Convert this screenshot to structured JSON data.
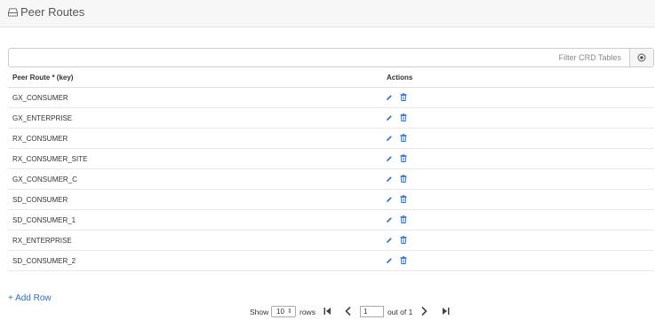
{
  "header": {
    "title": "Peer Routes",
    "icon": "hdd-icon"
  },
  "filter": {
    "placeholder": "Filter CRD Tables",
    "value": ""
  },
  "table": {
    "columns": [
      "Peer Route * (key)",
      "Actions"
    ],
    "rows": [
      "GX_CONSUMER",
      "GX_ENTERPRISE",
      "RX_CONSUMER",
      "RX_CONSUMER_SITE",
      "GX_CONSUMER_C",
      "SD_CONSUMER",
      "SD_CONSUMER_1",
      "RX_ENTERPRISE",
      "SD_CONSUMER_2"
    ]
  },
  "add_row": {
    "label": "+ Add Row"
  },
  "pagination": {
    "show_label": "Show",
    "rows_per_page": "10",
    "rows_label": "rows",
    "current_page": "1",
    "out_of_label": "out of 1"
  },
  "colors": {
    "accent": "#2d72c7",
    "header_bg": "#f7f7f7"
  }
}
